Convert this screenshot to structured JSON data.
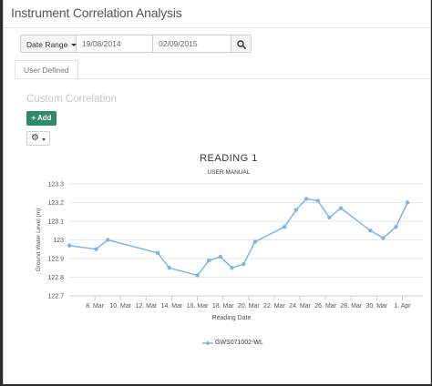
{
  "app": {
    "title": "Instrument Correlation Analysis"
  },
  "filter": {
    "range_label": "Date Range",
    "date_from": "19/08/2014",
    "date_to": "02/09/2015"
  },
  "tabs": [
    {
      "label": "User Defined",
      "active": true
    }
  ],
  "section": {
    "title": "Custom Correlation",
    "add_label": "Add"
  },
  "colors": {
    "accent": "#2f8a6b",
    "series": "#7cb5ec"
  },
  "icons": {
    "search": "search-icon",
    "plus": "plus-icon",
    "settings": "gear-icon"
  },
  "chart_data": {
    "type": "line",
    "title": "READING 1",
    "subtitle": "USER MANUAL",
    "xlabel": "Reading Date",
    "ylabel": "Ground Water Level (m)",
    "ylim": [
      122.7,
      123.3
    ],
    "yticks": [
      "122.7",
      "122.8",
      "122.9",
      "123",
      "123.1",
      "123.2",
      "123.3"
    ],
    "x_day_range": [
      6,
      33.6
    ],
    "xticks": [
      {
        "day": 8,
        "label": "8. Mar"
      },
      {
        "day": 10,
        "label": "10. Mar"
      },
      {
        "day": 12,
        "label": "12. Mar"
      },
      {
        "day": 14,
        "label": "14. Mar"
      },
      {
        "day": 16,
        "label": "16. Mar"
      },
      {
        "day": 18,
        "label": "18. Mar"
      },
      {
        "day": 20,
        "label": "20. Mar"
      },
      {
        "day": 22,
        "label": "22. Mar"
      },
      {
        "day": 24,
        "label": "24. Mar"
      },
      {
        "day": 26,
        "label": "26. Mar"
      },
      {
        "day": 28,
        "label": "28. Mar"
      },
      {
        "day": 30,
        "label": "30. Mar"
      },
      {
        "day": 32,
        "label": "1. Apr"
      }
    ],
    "grid": true,
    "legend_position": "bottom",
    "series": [
      {
        "name": "GWS071002-WL",
        "points": [
          [
            6,
            122.97
          ],
          [
            8.1,
            122.95
          ],
          [
            9,
            123.0
          ],
          [
            12.9,
            122.93
          ],
          [
            13.8,
            122.85
          ],
          [
            16,
            122.81
          ],
          [
            16.9,
            122.89
          ],
          [
            17.8,
            122.91
          ],
          [
            18.7,
            122.85
          ],
          [
            19.6,
            122.87
          ],
          [
            20.5,
            122.99
          ],
          [
            22.8,
            123.07
          ],
          [
            23.7,
            123.16
          ],
          [
            24.5,
            123.22
          ],
          [
            25.4,
            123.21
          ],
          [
            26.3,
            123.12
          ],
          [
            27.2,
            123.17
          ],
          [
            29.5,
            123.05
          ],
          [
            30.5,
            123.01
          ],
          [
            31.5,
            123.07
          ],
          [
            32.4,
            123.2
          ]
        ]
      }
    ]
  }
}
